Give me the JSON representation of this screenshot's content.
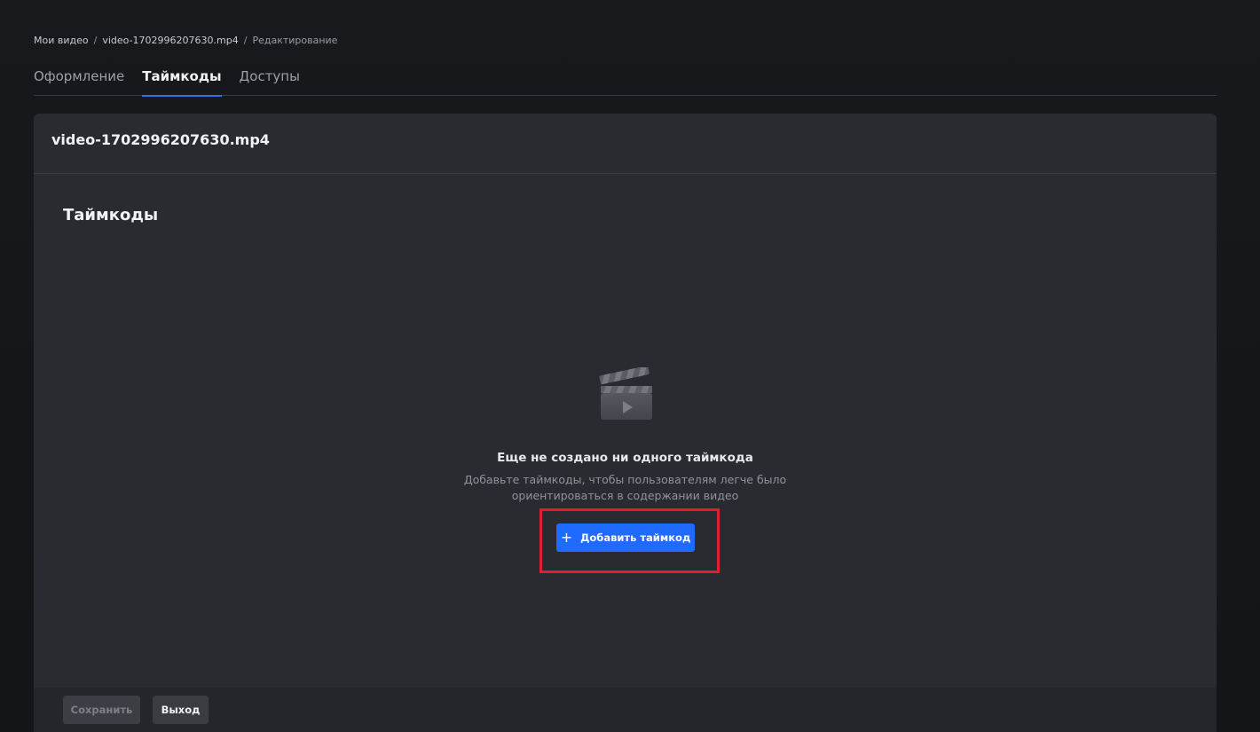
{
  "breadcrumb": {
    "items": [
      "Мои видео",
      "video-1702996207630.mp4",
      "Редактирование"
    ],
    "separator": "/"
  },
  "tabs": [
    {
      "label": "Оформление",
      "active": false
    },
    {
      "label": "Таймкоды",
      "active": true
    },
    {
      "label": "Доступы",
      "active": false
    }
  ],
  "card": {
    "title": "video-1702996207630.mp4",
    "section_title": "Таймкоды"
  },
  "empty_state": {
    "icon": "clapperboard-play-icon",
    "title": "Еще не создано ни одного таймкода",
    "description": "Добавьте таймкоды, чтобы пользователям легче было ориентироваться в содержании видео"
  },
  "add_button": {
    "icon": "plus-icon",
    "plus": "+",
    "label": "Добавить таймкод"
  },
  "footer": {
    "save_label": "Сохранить",
    "exit_label": "Выход"
  },
  "colors": {
    "accent": "#1f6bff",
    "tab_indicator": "#2f6fe8",
    "highlight": "#e01e2c",
    "card_bg": "#2a2b30",
    "page_bg": "#141619"
  }
}
